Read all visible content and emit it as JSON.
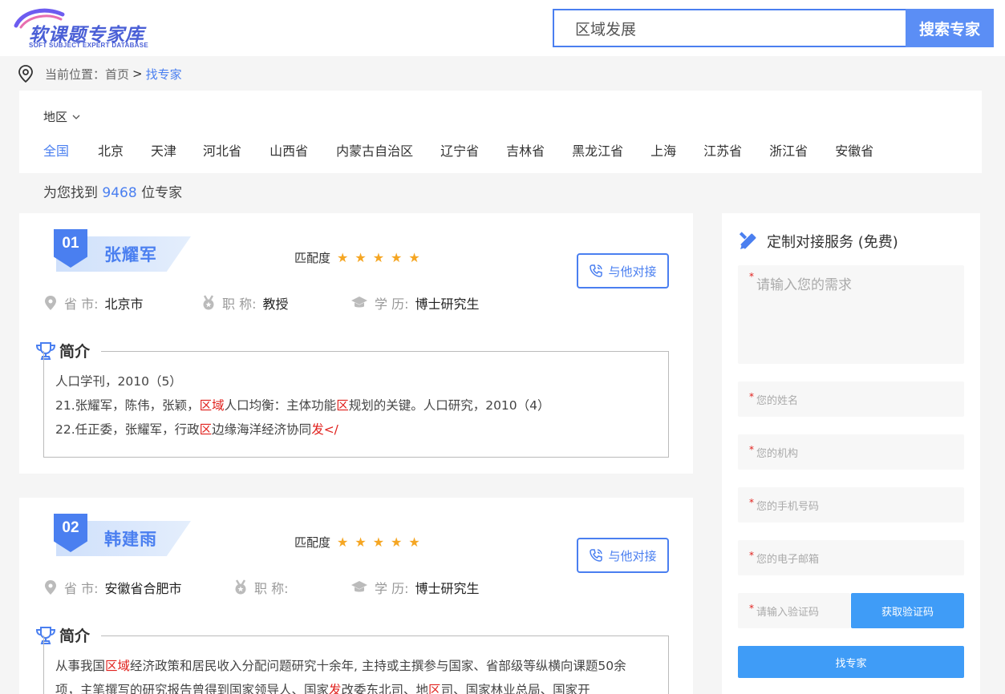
{
  "header": {
    "logo_text": "软课题专家库",
    "logo_sub": "SOFT SUBJECT EXPERT DATABASE",
    "search_value": "区域发展",
    "search_button": "搜索专家"
  },
  "breadcrumb": {
    "prefix": "当前位置：",
    "home": "首页",
    "separator": ">",
    "current": "找专家"
  },
  "filter": {
    "label": "地区",
    "regions": [
      "全国",
      "北京",
      "天津",
      "河北省",
      "山西省",
      "内蒙古自治区",
      "辽宁省",
      "吉林省",
      "黑龙江省",
      "上海",
      "江苏省",
      "浙江省",
      "安徽省"
    ]
  },
  "results": {
    "prefix": "为您找到",
    "count": "9468",
    "suffix": "位专家"
  },
  "labels": {
    "match": "匹配度",
    "stars": "★★★★★",
    "contact": "与他对接",
    "province": "省 市:",
    "title": "职 称:",
    "education": "学 历:",
    "intro": "简介"
  },
  "experts": [
    {
      "rank": "01",
      "name": "张耀军",
      "province": "北京市",
      "title": "教授",
      "education": "博士研究生",
      "intro_lines": [
        [
          {
            "t": "人口学刊，2010（5）"
          }
        ],
        [
          {
            "t": "21.张耀军，陈伟，张颖，"
          },
          {
            "t": "区域",
            "h": true
          },
          {
            "t": "人口均衡：主体功能"
          },
          {
            "t": "区",
            "h": true
          },
          {
            "t": "规划的关键。人口研究，2010（4）"
          }
        ],
        [
          {
            "t": "22.任正委，张耀军，行政"
          },
          {
            "t": "区",
            "h": true
          },
          {
            "t": "边缘海洋经济协同"
          },
          {
            "t": "发</",
            "h": true
          }
        ]
      ]
    },
    {
      "rank": "02",
      "name": "韩建雨",
      "province": "安徽省合肥市",
      "title": "",
      "education": "博士研究生",
      "intro_lines": [
        [
          {
            "t": "从事我国"
          },
          {
            "t": "区域",
            "h": true
          },
          {
            "t": "经济政策和居民收入分配问题研究十余年, 主持或主撰参与国家、省部级等纵横向课题50余"
          }
        ],
        [
          {
            "t": "项，主笔撰写的研究报告曾得到国家领导人、国家"
          },
          {
            "t": "发",
            "h": true
          },
          {
            "t": "改委东北司、地"
          },
          {
            "t": "区",
            "h": true
          },
          {
            "t": "司、国家林业总局、国家开"
          }
        ]
      ]
    }
  ],
  "side": {
    "title": "定制对接服务 (免费)",
    "need_placeholder": "请输入您的需求",
    "name_placeholder": "您的姓名",
    "org_placeholder": "您的机构",
    "phone_placeholder": "您的手机号码",
    "email_placeholder": "您的电子邮箱",
    "code_placeholder": "请输入验证码",
    "code_button": "获取验证码",
    "submit_button": "找专家",
    "required_mark": "*"
  }
}
